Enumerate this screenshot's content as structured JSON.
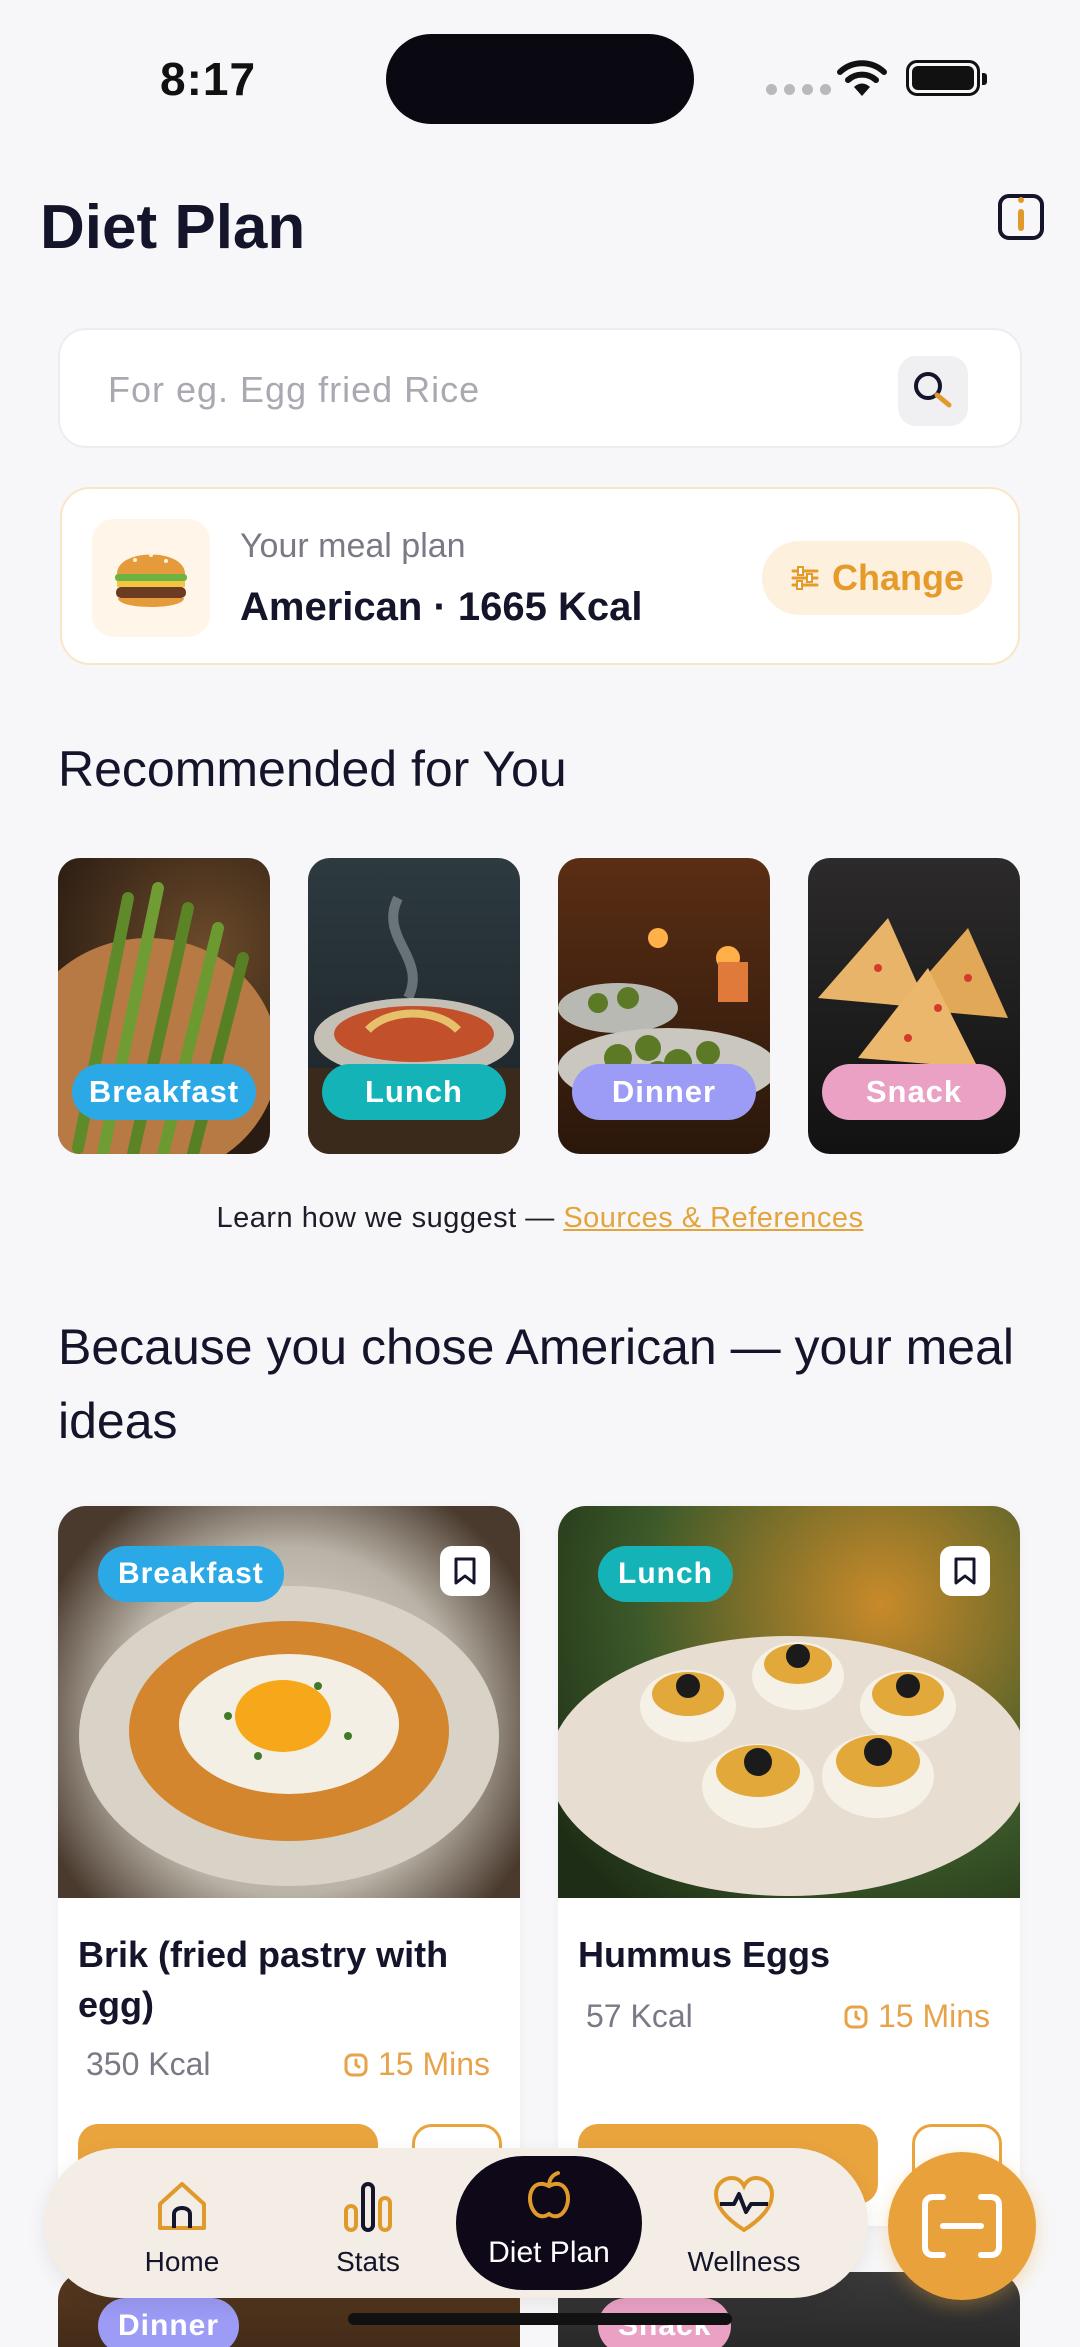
{
  "status_bar": {
    "time": "8:17"
  },
  "header": {
    "title": "Diet Plan",
    "info_icon": "info-icon"
  },
  "search": {
    "placeholder": "For eg. Egg fried Rice",
    "value": ""
  },
  "meal_plan": {
    "label": "Your meal plan",
    "value": "American · 1665 Kcal",
    "change_label": "Change",
    "emoji": "🍔"
  },
  "recommended": {
    "title": "Recommended for You",
    "items": [
      {
        "label": "Breakfast",
        "color": "#2aa9e6"
      },
      {
        "label": "Lunch",
        "color": "#14b3b7"
      },
      {
        "label": "Dinner",
        "color": "#9c9bf5"
      },
      {
        "label": "Snack",
        "color": "#eaa1c4"
      }
    ]
  },
  "learn": {
    "text": "Learn how we suggest — ",
    "link": "Sources & References"
  },
  "ideas": {
    "title": "Because you chose American — your meal ideas",
    "cards": [
      {
        "tag": "Breakfast",
        "tag_color": "#2aa9e6",
        "name": "Brik (fried pastry with egg)",
        "kcal": "350 Kcal",
        "time": "15 Mins"
      },
      {
        "tag": "Lunch",
        "tag_color": "#14b3b7",
        "name": "Hummus Eggs",
        "kcal": "57 Kcal",
        "time": "15 Mins"
      }
    ],
    "peek": [
      {
        "tag": "Dinner",
        "tag_color": "#9c9bf5"
      },
      {
        "tag": "Snack",
        "tag_color": "#eaa1c4"
      }
    ]
  },
  "nav": {
    "items": [
      {
        "label": "Home",
        "icon": "home-icon"
      },
      {
        "label": "Stats",
        "icon": "stats-icon"
      },
      {
        "label": "Diet Plan",
        "icon": "apple-icon"
      },
      {
        "label": "Wellness",
        "icon": "heart-pulse-icon"
      }
    ],
    "fab_icon": "scan-icon"
  },
  "colors": {
    "accent": "#e9a23b",
    "dark": "#0e0818"
  }
}
